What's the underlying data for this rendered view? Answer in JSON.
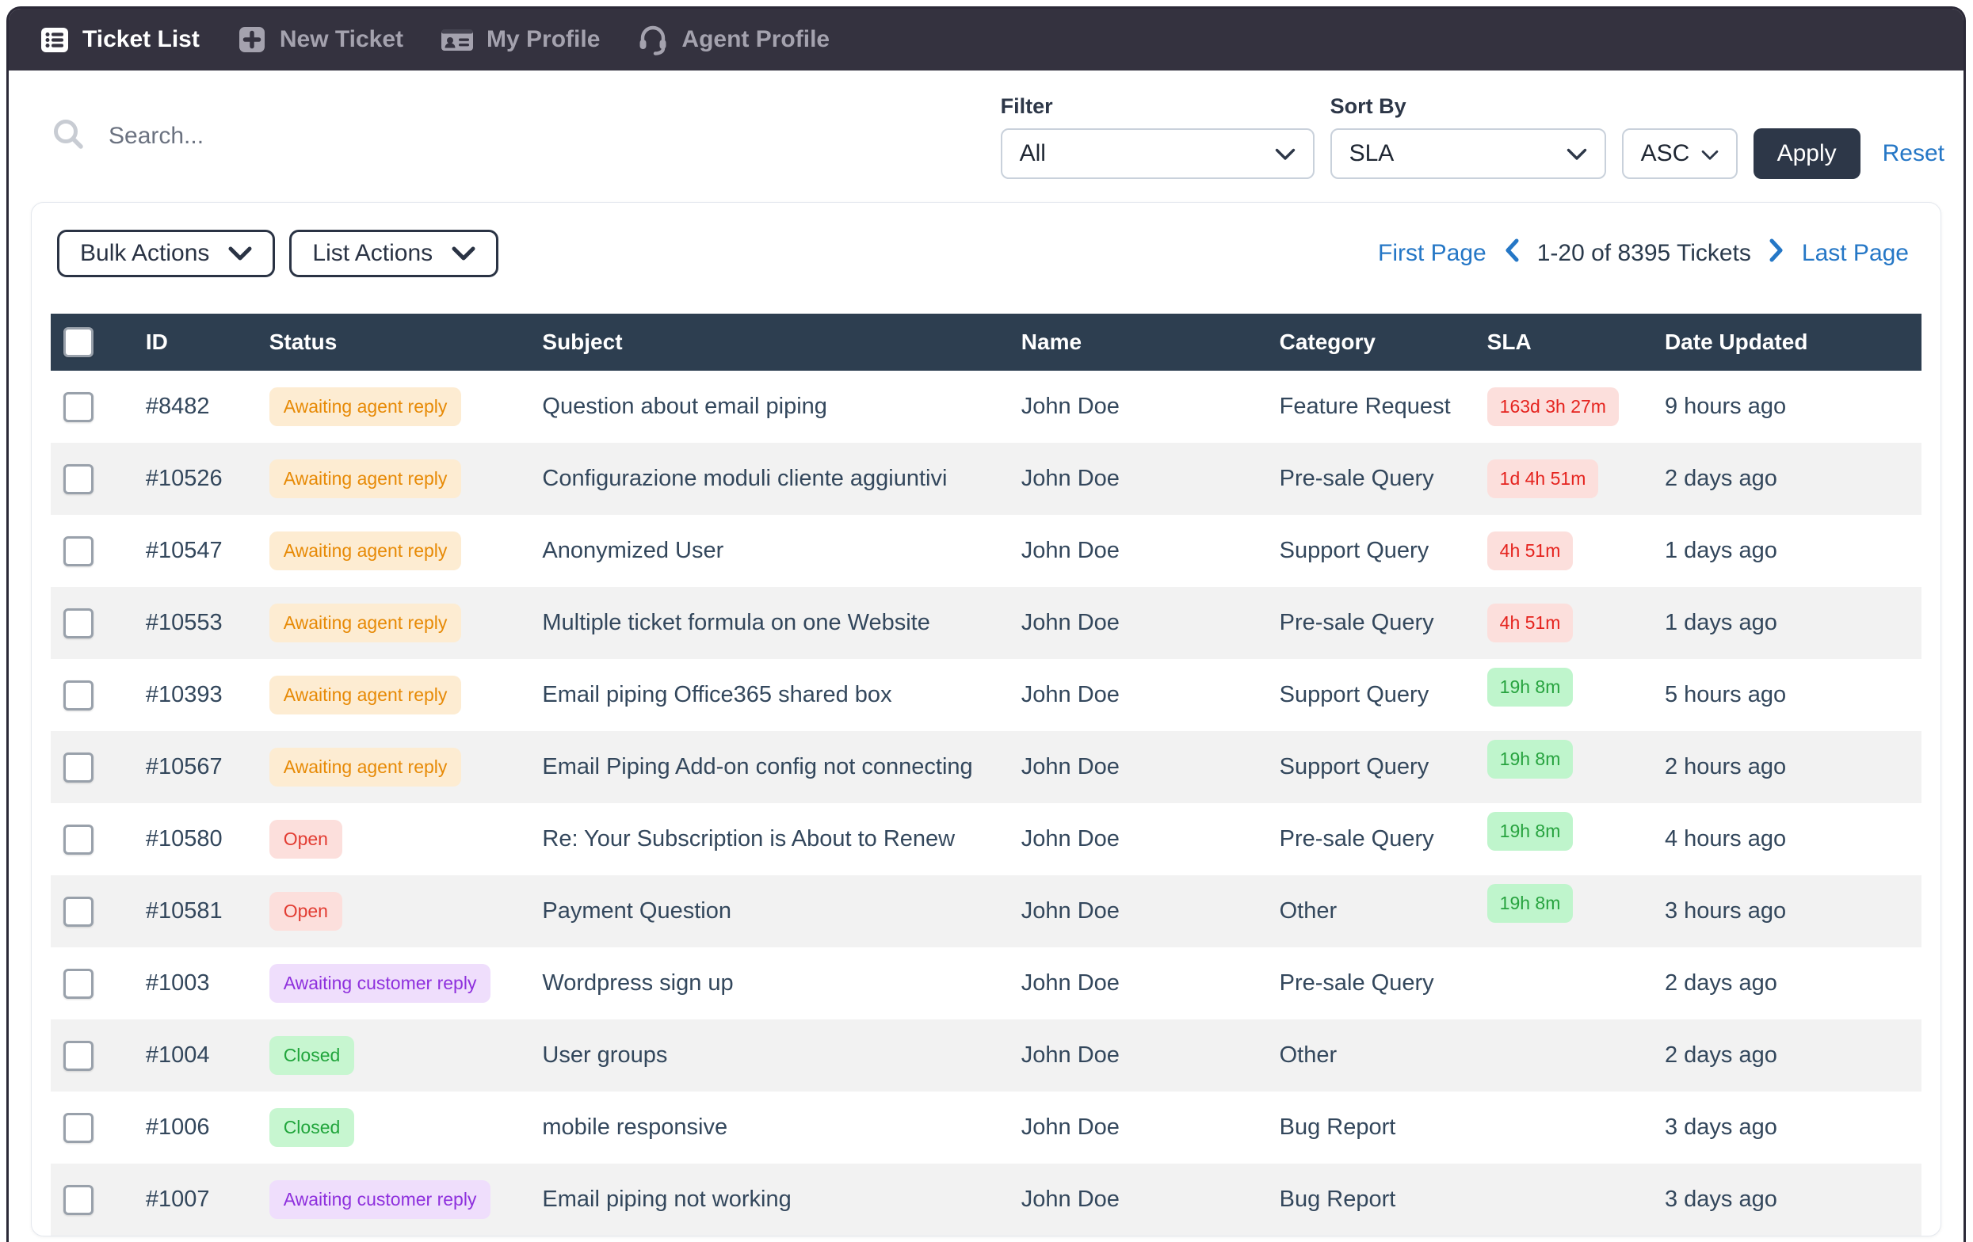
{
  "navbar": {
    "items": [
      {
        "label": "Ticket List",
        "icon": "ticket-list-icon",
        "active": true
      },
      {
        "label": "New Ticket",
        "icon": "new-ticket-icon",
        "active": false
      },
      {
        "label": "My Profile",
        "icon": "id-card-icon",
        "active": false
      },
      {
        "label": "Agent Profile",
        "icon": "headset-icon",
        "active": false
      }
    ]
  },
  "toolbar": {
    "search_placeholder": "Search...",
    "filter_label": "Filter",
    "filter_value": "All",
    "sort_label": "Sort By",
    "sort_value": "SLA",
    "order_value": "ASC",
    "apply_label": "Apply",
    "reset_label": "Reset"
  },
  "list_header": {
    "bulk_actions_label": "Bulk Actions",
    "list_actions_label": "List Actions",
    "pagination": {
      "first_label": "First Page",
      "range_text": "1-20 of 8395 Tickets",
      "last_label": "Last Page"
    }
  },
  "table": {
    "columns": [
      "ID",
      "Status",
      "Subject",
      "Name",
      "Category",
      "SLA",
      "Date Updated"
    ],
    "rows": [
      {
        "id": "#8482",
        "status": "Awaiting agent reply",
        "status_type": "awaiting-agent",
        "subject": "Question about email piping",
        "name": "John Doe",
        "category": "Feature Request",
        "sla": "163d 3h 27m",
        "sla_type": "red",
        "date_updated": "9 hours ago"
      },
      {
        "id": "#10526",
        "status": "Awaiting agent reply",
        "status_type": "awaiting-agent",
        "subject": "Configurazione moduli cliente aggiuntivi",
        "name": "John Doe",
        "category": "Pre-sale Query",
        "sla": "1d 4h 51m",
        "sla_type": "red",
        "date_updated": "2 days ago"
      },
      {
        "id": "#10547",
        "status": "Awaiting agent reply",
        "status_type": "awaiting-agent",
        "subject": "Anonymized User",
        "name": "John Doe",
        "category": "Support Query",
        "sla": "4h 51m",
        "sla_type": "red",
        "date_updated": "1 days ago"
      },
      {
        "id": "#10553",
        "status": "Awaiting agent reply",
        "status_type": "awaiting-agent",
        "subject": "Multiple ticket formula on one Website",
        "name": "John Doe",
        "category": "Pre-sale Query",
        "sla": "4h 51m",
        "sla_type": "red",
        "date_updated": "1 days ago"
      },
      {
        "id": "#10393",
        "status": "Awaiting agent reply",
        "status_type": "awaiting-agent",
        "subject": "Email piping Office365 shared box",
        "name": "John Doe",
        "category": "Support Query",
        "sla": "19h 8m",
        "sla_type": "green",
        "date_updated": "5 hours ago"
      },
      {
        "id": "#10567",
        "status": "Awaiting agent reply",
        "status_type": "awaiting-agent",
        "subject": "Email Piping Add-on config not connecting",
        "name": "John Doe",
        "category": "Support Query",
        "sla": "19h 8m",
        "sla_type": "green",
        "date_updated": "2 hours ago"
      },
      {
        "id": "#10580",
        "status": "Open",
        "status_type": "open",
        "subject": "Re: Your Subscription is About to Renew",
        "name": "John Doe",
        "category": "Pre-sale Query",
        "sla": "19h 8m",
        "sla_type": "green",
        "date_updated": "4 hours ago"
      },
      {
        "id": "#10581",
        "status": "Open",
        "status_type": "open",
        "subject": "Payment Question",
        "name": "John Doe",
        "category": "Other",
        "sla": "19h 8m",
        "sla_type": "green",
        "date_updated": "3 hours ago"
      },
      {
        "id": "#1003",
        "status": "Awaiting customer reply",
        "status_type": "awaiting-customer",
        "subject": "Wordpress sign up",
        "name": "John Doe",
        "category": "Pre-sale Query",
        "sla": "",
        "sla_type": null,
        "date_updated": "2 days ago"
      },
      {
        "id": "#1004",
        "status": "Closed",
        "status_type": "closed",
        "subject": "User groups",
        "name": "John Doe",
        "category": "Other",
        "sla": "",
        "sla_type": null,
        "date_updated": "2 days ago"
      },
      {
        "id": "#1006",
        "status": "Closed",
        "status_type": "closed",
        "subject": "mobile responsive",
        "name": "John Doe",
        "category": "Bug Report",
        "sla": "",
        "sla_type": null,
        "date_updated": "3 days ago"
      },
      {
        "id": "#1007",
        "status": "Awaiting customer reply",
        "status_type": "awaiting-customer",
        "subject": "Email piping not working",
        "name": "John Doe",
        "category": "Bug Report",
        "sla": "",
        "sla_type": null,
        "date_updated": "3 days ago"
      }
    ]
  },
  "colors": {
    "navbar_bg": "#34323f",
    "nav_active_text": "#ffffff",
    "nav_inactive_text": "#a4a2ae",
    "accent_blue": "#2577c6",
    "table_header_bg": "#2d3e50",
    "row_alt_bg": "#f2f2f2",
    "body_text": "#33475c",
    "apply_button_bg": "#2d3748",
    "status_awaiting_agent": {
      "bg": "#fdecd2",
      "text": "#e78a06"
    },
    "status_open": {
      "bg": "#fcdfdc",
      "text": "#e23c32"
    },
    "status_awaiting_customer": {
      "bg": "#efdefc",
      "text": "#8e30dd"
    },
    "status_closed": {
      "bg": "#c7f6d0",
      "text": "#21a53c"
    },
    "sla_red": {
      "bg": "#fcdfdc",
      "text": "#e5231e"
    },
    "sla_green": {
      "bg": "#bff5cc",
      "text": "#27a33f"
    }
  }
}
